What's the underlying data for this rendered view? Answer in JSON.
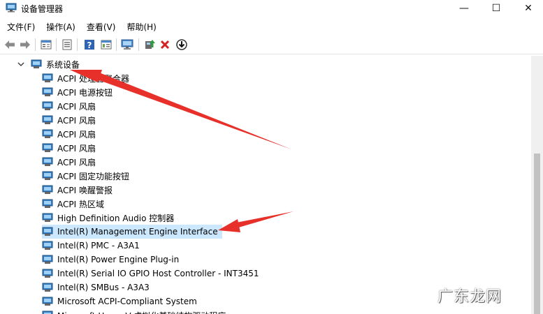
{
  "window": {
    "title": "设备管理器",
    "controls": {
      "minimize": "—",
      "maximize": "☐",
      "close": "✕"
    }
  },
  "menu": [
    "文件(F)",
    "操作(A)",
    "查看(V)",
    "帮助(H)"
  ],
  "toolbar": {
    "buttons": [
      "back-arrow-icon",
      "forward-arrow-icon",
      "properties-icon",
      "device-list-icon",
      "help-icon",
      "details-icon",
      "monitor-icon",
      "update-driver-icon",
      "uninstall-icon",
      "download-icon"
    ]
  },
  "tree": {
    "root": {
      "label": "系统设备",
      "expanded": true
    },
    "items": [
      {
        "label": "ACPI 处理器聚合器"
      },
      {
        "label": "ACPI 电源按钮"
      },
      {
        "label": "ACPI 风扇"
      },
      {
        "label": "ACPI 风扇"
      },
      {
        "label": "ACPI 风扇"
      },
      {
        "label": "ACPI 风扇"
      },
      {
        "label": "ACPI 风扇"
      },
      {
        "label": "ACPI 固定功能按钮"
      },
      {
        "label": "ACPI 唤醒警报"
      },
      {
        "label": "ACPI 热区域"
      },
      {
        "label": "High Definition Audio 控制器"
      },
      {
        "label": "Intel(R) Management Engine Interface",
        "selected": true
      },
      {
        "label": "Intel(R) PMC - A3A1"
      },
      {
        "label": "Intel(R) Power Engine Plug-in"
      },
      {
        "label": "Intel(R) Serial IO GPIO Host Controller - INT3451"
      },
      {
        "label": "Intel(R) SMBus - A3A3"
      },
      {
        "label": "Microsoft ACPI-Compliant System"
      },
      {
        "label": "Microsoft Hyper-V 虚拟化基础结构驱动程序"
      }
    ]
  },
  "annotations": {
    "arrow_color": "#e8302a"
  },
  "watermark": {
    "text": "广东龙网"
  }
}
